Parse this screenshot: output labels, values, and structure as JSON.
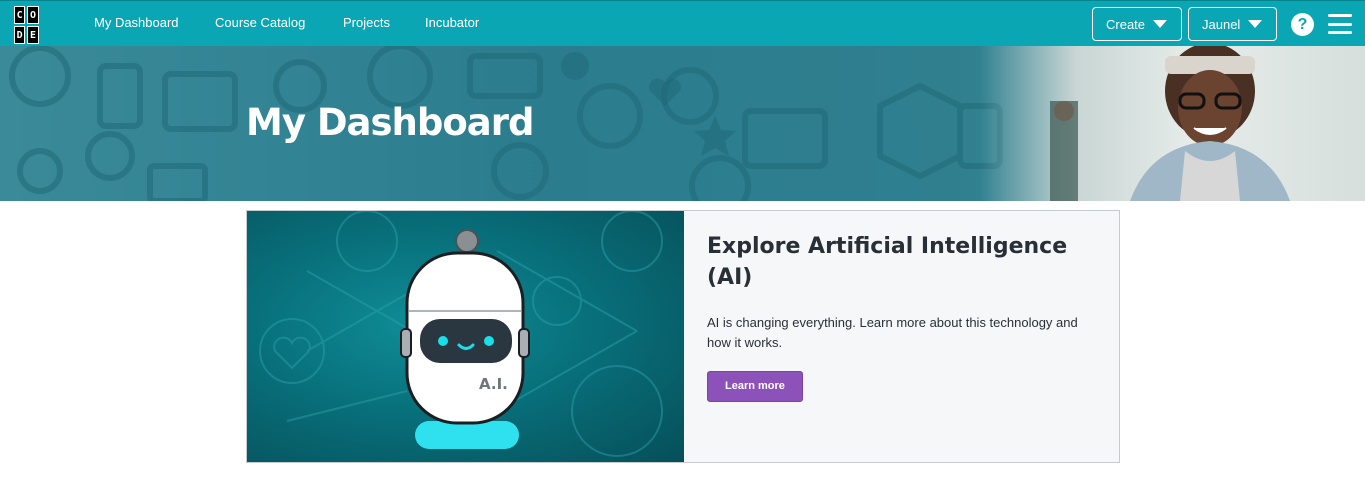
{
  "logo": {
    "letters": [
      "C",
      "O",
      "",
      "D",
      "E",
      ""
    ]
  },
  "nav": {
    "links": [
      "My Dashboard",
      "Course Catalog",
      "Projects",
      "Incubator"
    ],
    "create_label": "Create",
    "user_label": "Jaunel",
    "help_symbol": "?"
  },
  "hero": {
    "title": "My Dashboard"
  },
  "card": {
    "title": "Explore Artificial Intelligence (AI)",
    "description": "AI is changing everything. Learn more about this technology and how it works.",
    "button_label": "Learn more",
    "robot_label": "A.I."
  },
  "colors": {
    "nav_bg": "#0aa6b4",
    "hero_bg": "#2b7d8e",
    "button_purple": "#8c52ba",
    "robot_eye": "#19e0e8"
  }
}
